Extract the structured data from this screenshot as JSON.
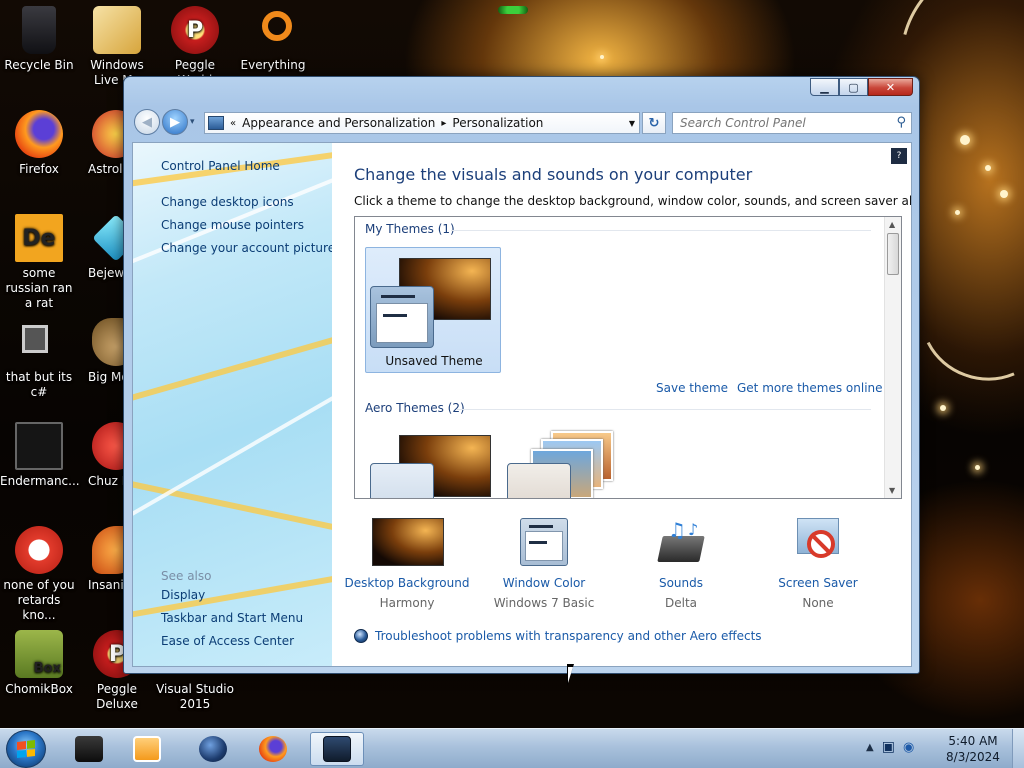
{
  "desktop": {
    "icons": [
      {
        "label": "Recycle Bin",
        "icon": "recycle-bin-icon",
        "color": "#1e1e22"
      },
      {
        "label": "Windows Live Ma",
        "icon": "mail-icon",
        "color": "#d7a53c"
      },
      {
        "label": "Peggle World",
        "icon": "peggle-icon",
        "color": "#c81e1e"
      },
      {
        "label": "Everything",
        "icon": "magnifier-icon",
        "color": "#f08a1b"
      },
      {
        "label": "Firefox",
        "icon": "firefox-icon",
        "color": "#e25c1b"
      },
      {
        "label": "Astrol Delu",
        "icon": "astro-icon",
        "color": "#c82a2a"
      },
      {
        "label": "some russian ran a rat",
        "icon": "de-icon",
        "color": "#f2a51f"
      },
      {
        "label": "Bejew Delu",
        "icon": "gem-icon",
        "color": "#23b6e0"
      },
      {
        "label": "that but its c#",
        "icon": "copy-icon",
        "color": "#7d7d7d"
      },
      {
        "label": "Big Mo Delu",
        "icon": "money-bag-icon",
        "color": "#8a6a33"
      },
      {
        "label": "Endermanc...",
        "icon": "terminal-icon",
        "color": "#2a2a2a"
      },
      {
        "label": "Chuz Delu",
        "icon": "chuzzle-icon",
        "color": "#cc2020"
      },
      {
        "label": "none of you retards kno...",
        "icon": "red-dragon-icon",
        "color": "#e23b2c"
      },
      {
        "label": "Insaniq Delu",
        "icon": "fish-icon",
        "color": "#e26420"
      },
      {
        "label": "ChomikBox",
        "icon": "chomikbox-icon",
        "color": "#7d9a3a"
      },
      {
        "label": "Peggle Deluxe",
        "icon": "peggle-deluxe-icon",
        "color": "#c81e1e"
      },
      {
        "label": "Visual Studio 2015",
        "icon": "visual-studio-icon",
        "color": "#000000"
      }
    ],
    "icon_glyphs": {
      "de": "De",
      "box": "Box",
      "p": "P"
    }
  },
  "window": {
    "caption_glyphs": {
      "minimize": "▁",
      "maximize": "▢",
      "close": "✕"
    },
    "nav": {
      "back": "◀",
      "forward": "▶",
      "history": "▾",
      "breadcrumb_prefix": "«",
      "breadcrumb": [
        "Appearance and Personalization",
        "Personalization"
      ],
      "breadcrumb_separator": "▸",
      "address_dropdown": "▼",
      "refresh": "↻",
      "search_placeholder": "Search Control Panel",
      "search_glyph": "⚲"
    },
    "left_pane": {
      "home": "Control Panel Home",
      "links": [
        "Change desktop icons",
        "Change mouse pointers",
        "Change your account picture"
      ],
      "see_also_header": "See also",
      "see_also": [
        "Display",
        "Taskbar and Start Menu",
        "Ease of Access Center"
      ]
    },
    "main": {
      "help_glyph": "?",
      "heading": "Change the visuals and sounds on your computer",
      "subtext": "Click a theme to change the desktop background, window color, sounds, and screen saver all at once.",
      "my_themes_label": "My Themes (1)",
      "unsaved_theme_label": "Unsaved Theme",
      "save_theme": "Save theme",
      "get_more_themes": "Get more themes online",
      "aero_themes_label": "Aero Themes (2)",
      "bottom_items": [
        {
          "label": "Desktop Background",
          "sub": "Harmony",
          "icon": "desktop-background-icon"
        },
        {
          "label": "Window Color",
          "sub": "Windows 7 Basic",
          "icon": "window-color-icon"
        },
        {
          "label": "Sounds",
          "sub": "Delta",
          "icon": "sounds-icon"
        },
        {
          "label": "Screen Saver",
          "sub": "None",
          "icon": "screen-saver-icon"
        }
      ],
      "troubleshoot": "Troubleshoot problems with transparency and other Aero effects"
    }
  },
  "taskbar": {
    "items": [
      {
        "name": "taskbar-terminal",
        "icon": "terminal-icon",
        "color": "#1a1a1a",
        "active": false
      },
      {
        "name": "taskbar-media-player",
        "icon": "media-player-icon",
        "color": "#f49a1c",
        "active": false
      },
      {
        "name": "taskbar-app-orb",
        "icon": "orb-icon",
        "color": "#1d3c6e",
        "active": false
      },
      {
        "name": "taskbar-firefox",
        "icon": "firefox-icon",
        "color": "#e25c1b",
        "active": false
      },
      {
        "name": "taskbar-control-panel",
        "icon": "control-panel-icon",
        "color": "#1e2d44",
        "active": true
      }
    ],
    "tray_glyphs": {
      "show_hidden": "▲",
      "network": "▣",
      "audio": "◉"
    },
    "time": "5:40 AM",
    "date": "8/3/2024"
  },
  "colors": {
    "link": "#1a5aa8",
    "heading": "#1c3f7a",
    "window_frame": "#a9c6e7",
    "close": "#c9463a"
  }
}
